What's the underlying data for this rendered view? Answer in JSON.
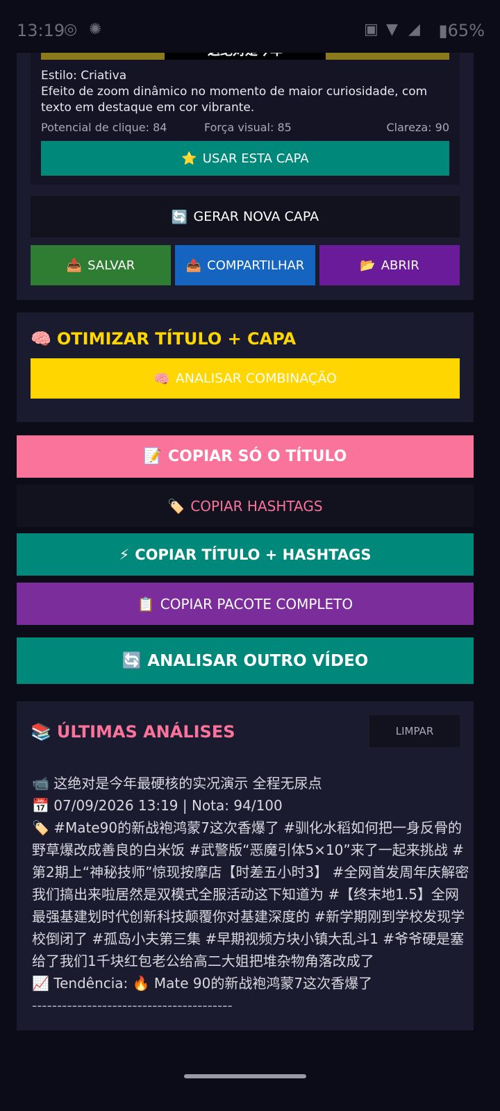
{
  "status_bar": {
    "time": "13:19",
    "battery": "65%"
  },
  "cover_card": {
    "image_text": "这绝对是今年",
    "style_label": "Estilo: Criativa",
    "description": "Efeito de zoom dinâmico no momento de maior curiosidade, com texto em destaque em cor vibrante.",
    "metrics": {
      "click": "Potencial de clique: 84",
      "visual": "Força visual: 85",
      "clarity": "Clareza: 90"
    },
    "use_button": "USAR ESTA CAPA"
  },
  "actions": {
    "generate": "GERAR NOVA CAPA",
    "save": "SALVAR",
    "share": "COMPARTILHAR",
    "open": "ABRIR"
  },
  "optimize": {
    "title": "OTIMIZAR TÍTULO + CAPA",
    "analyze": "ANALISAR COMBINAÇÃO"
  },
  "copy": {
    "title_only": "COPIAR SÓ O TÍTULO",
    "hashtags": "COPIAR HASHTAGS",
    "title_hashtags": "COPIAR TÍTULO + HASHTAGS",
    "full_package": "COPIAR PACOTE COMPLETO"
  },
  "analyze_other": "ANALISAR OUTRO VÍDEO",
  "history": {
    "title": "ÚLTIMAS ANÁLISES",
    "clear": "LIMPAR",
    "entry": {
      "video_title": "这绝对是今年最硬核的实况演示 全程无尿点",
      "date_score": "07/09/2026 13:19 | Nota: 94/100",
      "hashtags": "#Mate90的新战袍鸿蒙7这次香爆了 #驯化水稻如何把一身反骨的野草爆改成善良的白米饭 #武警版“恶魔引体5×10”来了一起来挑战 #第2期上“神秘技师”惊现按摩店【时差五小时3】 #全网首发周年庆解密我们搞出来啦居然是双模式全服活动这下知道为 #【终末地1.5】全网最强基建划时代创新科技颠覆你对基建深度的 #新学期刚到学校发现学校倒闭了 #孤岛小夫第三集 #早期视频方块小镇大乱斗1 #爷爷硬是塞给了我们1千块红包老公给高二大姐把堆杂物角落改成了",
      "trend": "Tendência: 🔥 Mate 90的新战袍鸿蒙7这次香爆了",
      "separator": "----------------------------------------"
    }
  },
  "colors": {
    "teal": "#00897b",
    "pink": "#f9739b",
    "purple": "#7b2d9b",
    "yellow": "#ffd600",
    "green": "#2e7d32",
    "blue": "#1565c0",
    "violet": "#6a1b9a"
  }
}
